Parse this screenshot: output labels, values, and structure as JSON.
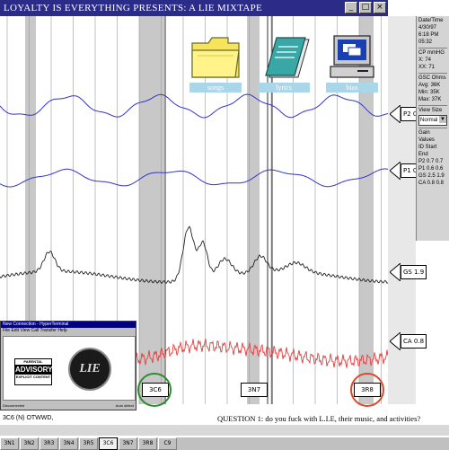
{
  "window": {
    "title": "LOYALTY IS EVERYTHING PRESENTS: A LIE MIXTAPE"
  },
  "side_panel": {
    "date_label": "Date/Time",
    "date": "4/30/97",
    "time": "6:18 PM",
    "elapsed": "05:32",
    "cp_label": "CP mmHG",
    "x_value": "X: 74",
    "xx_value": "XX: 71",
    "gsc_label": "GSC Ohms",
    "avg": "Avg: 36K",
    "min": "Min: 35K",
    "max": "Max: 37K",
    "view_size_label": "View Size",
    "view_size_value": "Normal",
    "gain_label": "Gain Values",
    "gain_header": "ID Start End",
    "gain_rows": [
      "P2  0.7  0.7",
      "P1  0.6  0.6",
      "GS  2.5  1.9",
      "CA  0.8  0.8"
    ]
  },
  "channels": [
    {
      "id": "P2",
      "value": "0.7"
    },
    {
      "id": "P1",
      "value": "0.6"
    },
    {
      "id": "GS",
      "value": "1.9"
    },
    {
      "id": "CA",
      "value": "0.8"
    }
  ],
  "icons": [
    {
      "label": "songs",
      "icon": "folder-icon"
    },
    {
      "label": "lyrics",
      "icon": "notepad-icon"
    },
    {
      "label": "bios",
      "icon": "computer-icon"
    }
  ],
  "segments": [
    "3C6",
    "3N7",
    "3R8"
  ],
  "colors": {
    "title_bar": "#2b2b88",
    "blue_trace": "#3333cc",
    "black_trace": "#222222",
    "red_trace": "#e04040",
    "green_circle": "#2e8b2e",
    "red_circle": "#d84a2a",
    "label_bg": "#a9d6e8"
  },
  "mini_window": {
    "title": "New Connection - HyperTerminal",
    "menu": "File  Edit  View  Call  Transfer  Help",
    "advisory_top": "PARENTAL",
    "advisory_mid": "ADVISORY",
    "advisory_bottom": "EXPLICIT CONTENT",
    "logo_text": "LIE",
    "status_left": "Disconnected",
    "status_right": "Auto detect"
  },
  "status_line": "3C6 (N) OTWWD,",
  "question": "QUESTION 1: do you fuck with L.I.E, their music, and activities?",
  "tabs": [
    "3N1",
    "3N2",
    "3R3",
    "3N4",
    "3R5",
    "3C6",
    "3N7",
    "3R8",
    "C9"
  ],
  "active_tab": "3C6"
}
